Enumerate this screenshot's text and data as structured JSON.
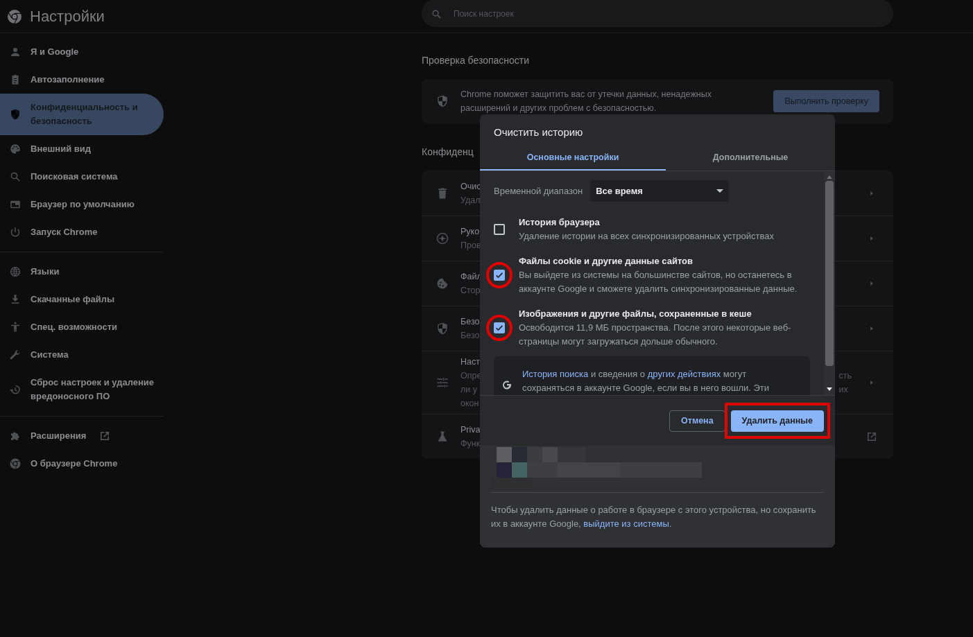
{
  "header": {
    "title": "Настройки",
    "search": {
      "placeholder": "Поиск настроек"
    }
  },
  "sidebar": {
    "groups": [
      [
        {
          "label": "Я и Google",
          "selected": false,
          "external": false
        },
        {
          "label": "Автозаполнение",
          "selected": false,
          "external": false
        },
        {
          "label": "Конфиденциальность и безопасность",
          "selected": true,
          "external": false
        },
        {
          "label": "Внешний вид",
          "selected": false,
          "external": false
        },
        {
          "label": "Поисковая система",
          "selected": false,
          "external": false
        },
        {
          "label": "Браузер по умолчанию",
          "selected": false,
          "external": false
        },
        {
          "label": "Запуск Chrome",
          "selected": false,
          "external": false
        }
      ],
      [
        {
          "label": "Языки",
          "selected": false,
          "external": false
        },
        {
          "label": "Скачанные файлы",
          "selected": false,
          "external": false
        },
        {
          "label": "Спец. возможности",
          "selected": false,
          "external": false
        },
        {
          "label": "Система",
          "selected": false,
          "external": false
        },
        {
          "label": "Сброс настроек и удаление вредоносного ПО",
          "selected": false,
          "external": false
        }
      ],
      [
        {
          "label": "Расширения",
          "selected": false,
          "external": true
        },
        {
          "label": "О браузере Chrome",
          "selected": false,
          "external": false
        }
      ]
    ]
  },
  "safety_check": {
    "heading": "Проверка безопасности",
    "text": "Chrome поможет защитить вас от утечки данных, ненадежных расширений и других проблем с безопасностью.",
    "button": "Выполнить проверку"
  },
  "privacy": {
    "heading": "Конфиденц",
    "rows": [
      {
        "lines": [
          "Очис",
          "Удал"
        ],
        "right_lines": [],
        "external": false
      },
      {
        "lines": [
          "Руко",
          "Пров"
        ],
        "right_lines": [],
        "external": false
      },
      {
        "lines": [
          "Файл",
          "Стор"
        ],
        "right_lines": [],
        "external": false
      },
      {
        "lines": [
          "Безо",
          "Безо"
        ],
        "right_lines": [],
        "external": false
      },
      {
        "lines": [
          "Наст",
          "Опре",
          "ли у",
          "окон"
        ],
        "right_lines": [
          "сть",
          "их"
        ],
        "external": false
      },
      {
        "lines": [
          "Priva",
          "Функ"
        ],
        "right_lines": [],
        "external": true
      }
    ]
  },
  "dialog": {
    "title": "Очистить историю",
    "tabs": [
      {
        "label": "Основные настройки",
        "selected": true
      },
      {
        "label": "Дополнительные",
        "selected": false
      }
    ],
    "time_range": {
      "label": "Временной диапазон",
      "value": "Все время"
    },
    "options": [
      {
        "title": "История браузера",
        "description": "Удаление истории на всех синхронизированных устройствах",
        "checked": false,
        "highlighted": false
      },
      {
        "title": "Файлы cookie и другие данные сайтов",
        "description": "Вы выйдете из системы на большинстве сайтов, но останетесь в аккаунте Google и сможете удалить синхронизированные данные.",
        "checked": true,
        "highlighted": true
      },
      {
        "title": "Изображения и другие файлы, сохраненные в кеше",
        "description": "Освободится 11,9 МБ пространства. После этого некоторые веб-страницы могут загружаться дольше обычного.",
        "checked": true,
        "highlighted": true
      }
    ],
    "info": [
      [
        {
          "text": "История поиска",
          "link": true
        },
        {
          "text": " и сведения о ",
          "link": false
        },
        {
          "text": "других действиях",
          "link": true
        },
        {
          "text": " могут",
          "link": false
        }
      ],
      [
        {
          "text": "сохраняться в аккаунте Google, если вы в него вошли. Эти",
          "link": false
        }
      ]
    ],
    "buttons": [
      {
        "label": "Отмена",
        "kind": "secondary",
        "highlighted": false
      },
      {
        "label": "Удалить данные",
        "kind": "primary",
        "highlighted": true
      }
    ],
    "account": {
      "kind": "picture"
    },
    "footer": [
      [
        {
          "text": "Чтобы удалить данные о работе в браузере с этого устройства, но сохранить",
          "link": false
        }
      ],
      [
        {
          "text": "их в аккаунте Google, ",
          "link": false
        },
        {
          "text": "выйдите из системы",
          "link": true
        },
        {
          "text": ".",
          "link": false
        }
      ]
    ]
  }
}
